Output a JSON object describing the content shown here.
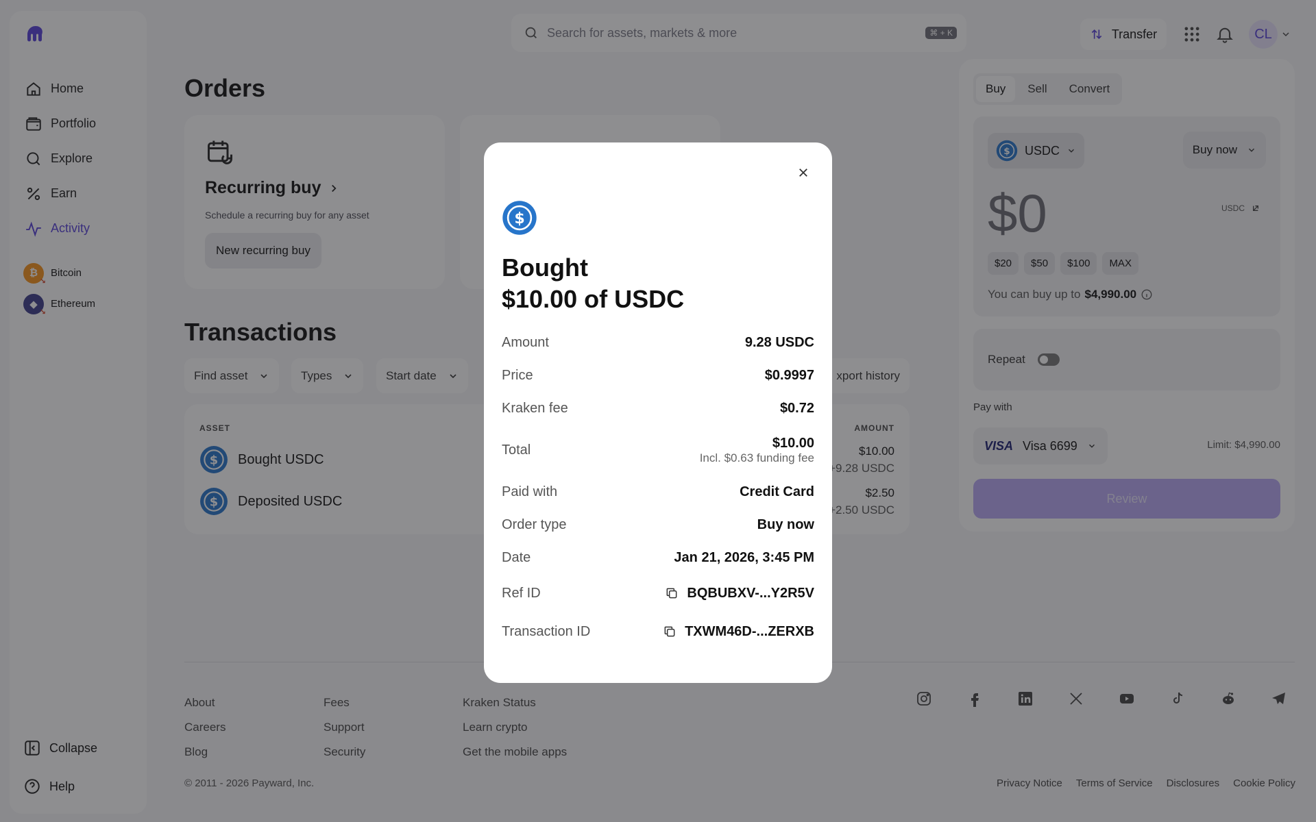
{
  "brand": {
    "accent": "#5741d9",
    "usdc_blue": "#2775ca",
    "bitcoin_orange": "#f7931a",
    "ethereum_purple": "#4a3aa8"
  },
  "sidebar": {
    "nav": [
      {
        "label": "Home",
        "icon": "home-icon"
      },
      {
        "label": "Portfolio",
        "icon": "wallet-icon"
      },
      {
        "label": "Explore",
        "icon": "search-icon"
      },
      {
        "label": "Earn",
        "icon": "percent-icon"
      },
      {
        "label": "Activity",
        "icon": "activity-icon",
        "active": true
      }
    ],
    "assets": [
      {
        "label": "Bitcoin",
        "symbol": "₿"
      },
      {
        "label": "Ethereum",
        "symbol": "◆"
      }
    ],
    "collapse_label": "Collapse",
    "help_label": "Help"
  },
  "topbar": {
    "search_placeholder": "Search for assets, markets & more",
    "search_shortcut": "⌘ + K",
    "transfer_label": "Transfer",
    "avatar_initials": "CL"
  },
  "main": {
    "orders_title": "Orders",
    "recurring": {
      "title": "Recurring buy",
      "subtitle": "Schedule a recurring buy for any asset",
      "button": "New recurring buy"
    },
    "transactions_title": "Transactions",
    "filters": [
      "Find asset",
      "Types",
      "Start date"
    ],
    "export_label": "xport history",
    "table": {
      "col_asset": "ASSET",
      "col_amount": "AMOUNT",
      "rows": [
        {
          "name": "Bought USDC",
          "amount": "$10.00",
          "sub": "+9.28 USDC"
        },
        {
          "name": "Deposited USDC",
          "amount": "$2.50",
          "sub": "+2.50 USDC"
        }
      ]
    }
  },
  "trade": {
    "tabs": [
      "Buy",
      "Sell",
      "Convert"
    ],
    "asset": "USDC",
    "order_mode": "Buy now",
    "amount": "$0",
    "unit": "USDC",
    "quick": [
      "$20",
      "$50",
      "$100",
      "MAX"
    ],
    "limit_prefix": "You can buy up to",
    "limit_value": "$4,990.00",
    "repeat_label": "Repeat",
    "pay_with_label": "Pay with",
    "card_brand": "VISA",
    "card_name": "Visa 6699",
    "card_limit": "Limit: $4,990.00",
    "review_label": "Review"
  },
  "footer": {
    "col1": [
      "About",
      "Careers",
      "Blog"
    ],
    "col2": [
      "Fees",
      "Support",
      "Security"
    ],
    "col3": [
      "Kraken Status",
      "Learn crypto",
      "Get the mobile apps"
    ],
    "socials": [
      "instagram-icon",
      "facebook-icon",
      "linkedin-icon",
      "x-icon",
      "youtube-icon",
      "tiktok-icon",
      "reddit-icon",
      "telegram-icon"
    ],
    "copyright": "© 2011 - 2026 Payward, Inc.",
    "legal": [
      "Privacy Notice",
      "Terms of Service",
      "Disclosures",
      "Cookie Policy"
    ]
  },
  "modal": {
    "title_line1": "Bought",
    "title_line2": "$10.00 of USDC",
    "amount_label": "Amount",
    "amount_value": "9.28 USDC",
    "price_label": "Price",
    "price_value": "$0.9997",
    "fee_label": "Kraken fee",
    "fee_value": "$0.72",
    "total_label": "Total",
    "total_value": "$10.00",
    "total_note": "Incl. $0.63 funding fee",
    "paid_label": "Paid with",
    "paid_value": "Credit Card",
    "type_label": "Order type",
    "type_value": "Buy now",
    "date_label": "Date",
    "date_value": "Jan 21, 2026, 3:45 PM",
    "ref_label": "Ref ID",
    "ref_value": "BQBUBXV-...Y2R5V",
    "txid_label": "Transaction ID",
    "txid_value": "TXWM46D-...ZERXB"
  }
}
